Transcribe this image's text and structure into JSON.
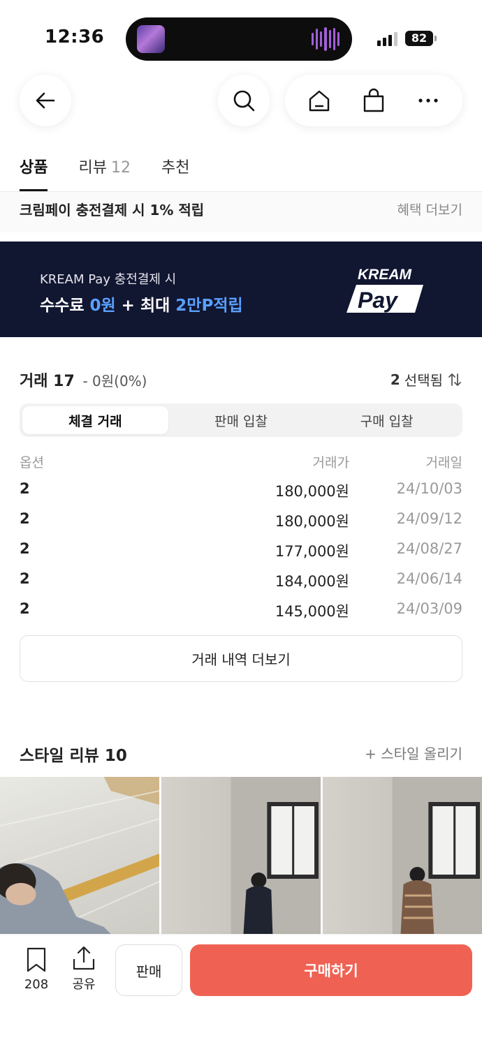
{
  "status_bar": {
    "time": "12:36",
    "battery": "82"
  },
  "nav": {
    "icons": [
      "back-arrow-icon",
      "search-icon",
      "home-icon",
      "shopping-bag-icon",
      "more-icon"
    ]
  },
  "tabs": [
    {
      "label": "상품",
      "count": ""
    },
    {
      "label": "리뷰",
      "count": "12"
    },
    {
      "label": "추천",
      "count": ""
    }
  ],
  "promo": {
    "text": "크림페이 충전결제 시 1% 적립",
    "more": "혜택 더보기"
  },
  "banner": {
    "line1": "KREAM Pay 충전결제 시",
    "line2_a": "수수료 ",
    "line2_b": "0원",
    "line2_c": " + 최대 ",
    "line2_d": "2만P적립",
    "logo_top": "KREAM",
    "logo_bottom": "Pay"
  },
  "trades": {
    "title": "거래 17",
    "sub": "- 0원(0%)",
    "selected_count": "2",
    "selected_label": "선택됨",
    "segments": [
      "체결 거래",
      "판매 입찰",
      "구매 입찰"
    ],
    "columns": [
      "옵션",
      "거래가",
      "거래일"
    ],
    "rows": [
      {
        "option": "2",
        "price": "180,000원",
        "date": "24/10/03"
      },
      {
        "option": "2",
        "price": "180,000원",
        "date": "24/09/12"
      },
      {
        "option": "2",
        "price": "177,000원",
        "date": "24/08/27"
      },
      {
        "option": "2",
        "price": "184,000원",
        "date": "24/06/14"
      },
      {
        "option": "2",
        "price": "145,000원",
        "date": "24/03/09"
      }
    ],
    "more_button": "거래 내역 더보기"
  },
  "style_review": {
    "title": "스타일 리뷰 10",
    "upload": "+ 스타일 올리기"
  },
  "bottom": {
    "bookmark_count": "208",
    "share_label": "공유",
    "sell_label": "판매",
    "buy_label": "구매하기"
  },
  "colors": {
    "buy": "#ef6253",
    "banner_bg": "#111631",
    "banner_highlight": "#5aa0ff"
  }
}
